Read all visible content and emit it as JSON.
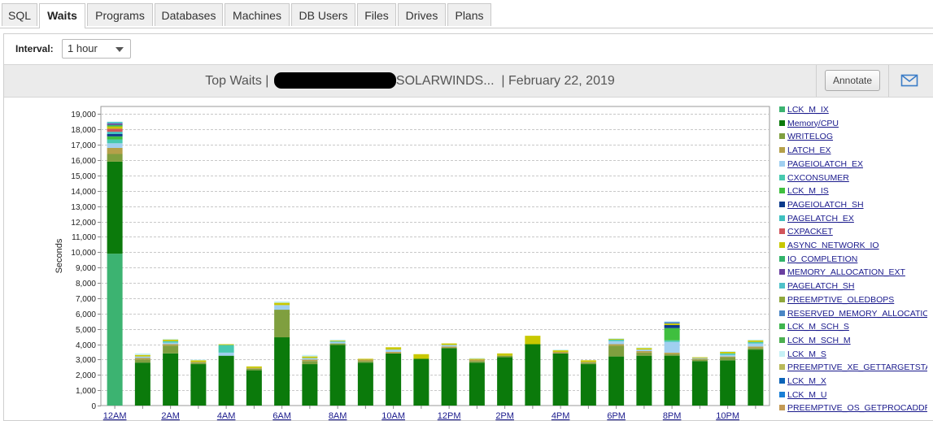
{
  "tabs": [
    {
      "label": "SQL",
      "active": false
    },
    {
      "label": "Waits",
      "active": true
    },
    {
      "label": "Programs",
      "active": false
    },
    {
      "label": "Databases",
      "active": false
    },
    {
      "label": "Machines",
      "active": false
    },
    {
      "label": "DB Users",
      "active": false
    },
    {
      "label": "Files",
      "active": false
    },
    {
      "label": "Drives",
      "active": false
    },
    {
      "label": "Plans",
      "active": false
    }
  ],
  "interval": {
    "label": "Interval:",
    "value": "1 hour"
  },
  "header": {
    "title_prefix": "Top Waits  |",
    "title_instance": "SOLARWINDS...",
    "title_suffix": "|  February 22, 2019",
    "annotate_label": "Annotate",
    "email_icon": "envelope-icon"
  },
  "chart_data": {
    "type": "bar",
    "stacked": true,
    "title": "",
    "ylabel": "Seconds",
    "xlabel": "",
    "ylim": [
      0,
      19500
    ],
    "y_ticks": [
      0,
      1000,
      2000,
      3000,
      4000,
      5000,
      6000,
      7000,
      8000,
      9000,
      10000,
      11000,
      12000,
      13000,
      14000,
      15000,
      16000,
      17000,
      18000,
      19000
    ],
    "y_tick_labels": [
      "0",
      "1,000",
      "2,000",
      "3,000",
      "4,000",
      "5,000",
      "6,000",
      "7,000",
      "8,000",
      "9,000",
      "10,000",
      "11,000",
      "12,000",
      "13,000",
      "14,000",
      "15,000",
      "16,000",
      "17,000",
      "18,000",
      "19,000"
    ],
    "x_tick_labels": [
      "12AM",
      "2AM",
      "4AM",
      "6AM",
      "8AM",
      "10AM",
      "12PM",
      "2PM",
      "4PM",
      "6PM",
      "8PM",
      "10PM"
    ],
    "categories": [
      "12AM",
      "1AM",
      "2AM",
      "3AM",
      "4AM",
      "5AM",
      "6AM",
      "7AM",
      "8AM",
      "9AM",
      "10AM",
      "11AM",
      "12PM",
      "1PM",
      "2PM",
      "3PM",
      "4PM",
      "5PM",
      "6PM",
      "7PM",
      "8PM",
      "9PM",
      "10PM",
      "11PM"
    ],
    "legend_position": "right",
    "grid": true,
    "series": [
      {
        "name": "LCK_M_IX",
        "color": "#3cb371",
        "values": [
          9900,
          0,
          0,
          0,
          0,
          0,
          0,
          0,
          0,
          0,
          0,
          0,
          0,
          0,
          0,
          0,
          0,
          0,
          0,
          0,
          0,
          0,
          0,
          0
        ]
      },
      {
        "name": "Memory/CPU",
        "color": "#0b7a0b",
        "values": [
          6000,
          2800,
          3400,
          2700,
          3250,
          2300,
          4450,
          2700,
          3950,
          2800,
          3400,
          3050,
          3750,
          2800,
          3150,
          4000,
          3400,
          2700,
          3200,
          3250,
          3250,
          2900,
          2950,
          3650
        ]
      },
      {
        "name": "WRITELOG",
        "color": "#7f9f3f",
        "values": [
          500,
          200,
          500,
          100,
          0,
          100,
          1800,
          200,
          100,
          100,
          0,
          0,
          0,
          100,
          100,
          0,
          0,
          100,
          700,
          200,
          100,
          100,
          200,
          100
        ]
      },
      {
        "name": "LATCH_EX",
        "color": "#b5a04a",
        "values": [
          400,
          100,
          100,
          50,
          0,
          50,
          0,
          100,
          0,
          100,
          100,
          0,
          100,
          100,
          0,
          0,
          100,
          50,
          100,
          100,
          100,
          50,
          50,
          100
        ]
      },
      {
        "name": "PAGEIOLATCH_EX",
        "color": "#a0cff0",
        "values": [
          300,
          100,
          100,
          0,
          200,
          0,
          300,
          100,
          100,
          0,
          150,
          0,
          100,
          0,
          0,
          0,
          0,
          0,
          200,
          100,
          700,
          50,
          100,
          200
        ]
      },
      {
        "name": "CXCONSUMER",
        "color": "#48c9b0",
        "values": [
          250,
          0,
          100,
          0,
          500,
          0,
          0,
          0,
          50,
          0,
          0,
          0,
          0,
          0,
          0,
          0,
          0,
          0,
          100,
          0,
          100,
          0,
          100,
          100
        ]
      },
      {
        "name": "LCK_M_IS",
        "color": "#3fbf3f",
        "values": [
          200,
          0,
          0,
          0,
          0,
          0,
          0,
          0,
          0,
          0,
          0,
          0,
          0,
          0,
          0,
          0,
          0,
          0,
          0,
          0,
          800,
          0,
          0,
          0
        ]
      },
      {
        "name": "PAGEIOLATCH_SH",
        "color": "#0b3a8c",
        "values": [
          150,
          0,
          0,
          0,
          0,
          0,
          0,
          0,
          0,
          0,
          0,
          0,
          0,
          0,
          0,
          0,
          0,
          0,
          0,
          0,
          200,
          0,
          0,
          0
        ]
      },
      {
        "name": "PAGELATCH_EX",
        "color": "#40c0c0",
        "values": [
          150,
          0,
          0,
          0,
          0,
          0,
          0,
          0,
          0,
          0,
          0,
          0,
          0,
          0,
          0,
          0,
          0,
          0,
          0,
          0,
          0,
          0,
          0,
          0
        ]
      },
      {
        "name": "CXPACKET",
        "color": "#d1555b",
        "values": [
          200,
          0,
          0,
          0,
          0,
          0,
          0,
          0,
          0,
          0,
          0,
          0,
          0,
          0,
          0,
          0,
          0,
          0,
          0,
          0,
          0,
          0,
          0,
          0
        ]
      },
      {
        "name": "ASYNC_NETWORK_IO",
        "color": "#c8c800",
        "values": [
          150,
          100,
          100,
          100,
          50,
          100,
          150,
          100,
          50,
          50,
          150,
          300,
          100,
          50,
          150,
          550,
          100,
          100,
          50,
          100,
          100,
          50,
          100,
          100
        ]
      },
      {
        "name": "IO_COMPLETION",
        "color": "#32b36b",
        "values": [
          100,
          0,
          0,
          0,
          0,
          0,
          0,
          0,
          0,
          0,
          0,
          0,
          0,
          0,
          0,
          0,
          0,
          0,
          0,
          0,
          0,
          0,
          0,
          0
        ]
      },
      {
        "name": "MEMORY_ALLOCATION_EXT",
        "color": "#6a3fa0",
        "values": [
          100,
          0,
          0,
          0,
          0,
          0,
          0,
          0,
          0,
          0,
          0,
          0,
          0,
          0,
          0,
          0,
          0,
          0,
          0,
          0,
          0,
          0,
          0,
          0
        ]
      },
      {
        "name": "PAGELATCH_SH",
        "color": "#4fc1c9",
        "values": [
          100,
          0,
          0,
          0,
          0,
          0,
          0,
          0,
          0,
          0,
          0,
          0,
          0,
          0,
          0,
          0,
          0,
          0,
          0,
          0,
          0,
          0,
          0,
          0
        ]
      },
      {
        "name": "PREEMPTIVE_OLEDBOPS",
        "color": "#8fa83c",
        "values": [
          0,
          0,
          0,
          0,
          0,
          0,
          0,
          0,
          0,
          0,
          0,
          0,
          0,
          0,
          0,
          0,
          0,
          0,
          0,
          0,
          0,
          0,
          0,
          0
        ]
      },
      {
        "name": "RESERVED_MEMORY_ALLOCATION_EXT",
        "color": "#4a86c5",
        "values": [
          0,
          0,
          0,
          0,
          0,
          0,
          0,
          0,
          0,
          0,
          0,
          0,
          0,
          0,
          0,
          0,
          0,
          0,
          0,
          0,
          100,
          0,
          0,
          0
        ]
      },
      {
        "name": "LCK_M_SCH_S",
        "color": "#3fb54f",
        "values": [
          0,
          0,
          0,
          0,
          0,
          0,
          0,
          0,
          0,
          0,
          0,
          0,
          0,
          0,
          0,
          0,
          0,
          0,
          0,
          0,
          0,
          0,
          0,
          0
        ]
      },
      {
        "name": "LCK_M_SCH_M",
        "color": "#4caf50",
        "values": [
          0,
          0,
          0,
          0,
          0,
          0,
          0,
          0,
          0,
          0,
          0,
          0,
          0,
          0,
          0,
          0,
          0,
          0,
          0,
          0,
          0,
          0,
          0,
          0
        ]
      },
      {
        "name": "LCK_M_S",
        "color": "#c6f0f5",
        "values": [
          0,
          100,
          50,
          50,
          0,
          0,
          100,
          100,
          50,
          0,
          0,
          0,
          0,
          50,
          0,
          0,
          50,
          0,
          50,
          50,
          50,
          0,
          50,
          50
        ]
      },
      {
        "name": "PREEMPTIVE_XE_GETTARGETSTATE",
        "color": "#b9b95a",
        "values": [
          0,
          0,
          0,
          0,
          0,
          0,
          0,
          0,
          0,
          0,
          0,
          0,
          0,
          0,
          0,
          0,
          0,
          0,
          0,
          0,
          0,
          0,
          0,
          0
        ]
      },
      {
        "name": "LCK_M_X",
        "color": "#0c63b7",
        "values": [
          0,
          0,
          0,
          0,
          0,
          0,
          0,
          0,
          0,
          0,
          0,
          0,
          0,
          0,
          0,
          0,
          0,
          0,
          0,
          0,
          0,
          0,
          0,
          0
        ]
      },
      {
        "name": "LCK_M_U",
        "color": "#1a7fd6",
        "values": [
          0,
          0,
          0,
          0,
          0,
          0,
          0,
          0,
          0,
          0,
          0,
          0,
          0,
          0,
          0,
          0,
          0,
          0,
          0,
          0,
          0,
          0,
          0,
          0
        ]
      },
      {
        "name": "PREEMPTIVE_OS_GETPROCADDRESS",
        "color": "#c49a55",
        "values": [
          0,
          0,
          0,
          0,
          0,
          0,
          0,
          0,
          0,
          0,
          0,
          0,
          0,
          0,
          0,
          0,
          0,
          0,
          0,
          0,
          0,
          0,
          0,
          0
        ]
      }
    ]
  },
  "legend_labels": [
    "LCK_M_IX",
    "Memory/CPU",
    "WRITELOG",
    "LATCH_EX",
    "PAGEIOLATCH_EX",
    "CXCONSUMER",
    "LCK_M_IS",
    "PAGEIOLATCH_SH",
    "PAGELATCH_EX",
    "CXPACKET",
    "ASYNC_NETWORK_IO",
    "IO_COMPLETION",
    "MEMORY_ALLOCATION_EXT",
    "PAGELATCH_SH",
    "PREEMPTIVE_OLEDBOPS",
    "RESERVED_MEMORY_ALLOCATIO",
    "LCK_M_SCH_S",
    "LCK_M_SCH_M",
    "LCK_M_S",
    "PREEMPTIVE_XE_GETTARGETSTAT",
    "LCK_M_X",
    "LCK_M_U",
    "PREEMPTIVE_OS_GETPROCADDRE"
  ]
}
